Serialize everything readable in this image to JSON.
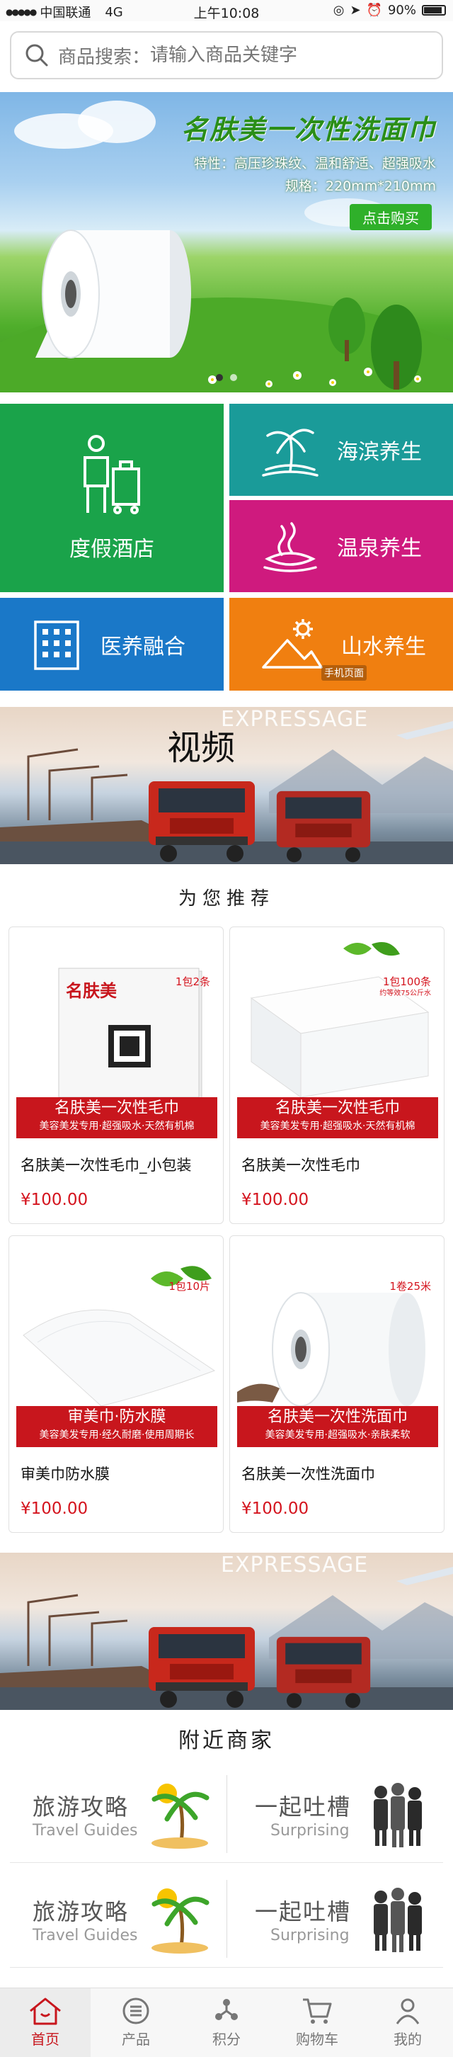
{
  "status_bar": {
    "carrier": "中国联通",
    "network": "4G",
    "time": "上午10:08",
    "battery": "90%",
    "battery_level": 0.9
  },
  "search": {
    "label": "商品搜索：",
    "placeholder": "请输入商品关键字"
  },
  "banner": {
    "title": "名肤美一次性洗面巾",
    "features": "特性：高压珍珠纹、温和舒适、超强吸水",
    "spec": "规格：220mm*210mm",
    "button": "点击购买",
    "slides": 2,
    "active_slide": 1
  },
  "categories": [
    {
      "label": "度假酒店",
      "icon": "traveler-luggage-icon",
      "color": "#1aa34a"
    },
    {
      "label": "海滨养生",
      "icon": "palm-island-icon",
      "color": "#1a9b99"
    },
    {
      "label": "温泉养生",
      "icon": "hot-spring-icon",
      "color": "#cf1a7e"
    },
    {
      "label": "医养融合",
      "icon": "building-icon",
      "color": "#1a78c8"
    },
    {
      "label": "山水养生",
      "icon": "mountain-sun-icon",
      "color": "#f07f10"
    }
  ],
  "category_watermark": "手机页面",
  "video_banner": {
    "overlay": "EXPRESSAGE",
    "label": "视频"
  },
  "promo_banner": {
    "overlay": "EXPRESSAGE"
  },
  "recommend": {
    "title": "为您推荐",
    "products": [
      {
        "name": "名肤美一次性毛巾_小包装",
        "price": "¥100.00",
        "pack": "1包2条",
        "bar_title": "名肤美一次性毛巾",
        "bar_sub": "美容美发专用·超强吸水·天然有机棉",
        "icon": "towel-pack-icon",
        "brand": "名肤美"
      },
      {
        "name": "名肤美一次性毛巾",
        "price": "¥100.00",
        "pack": "1包100条",
        "pack_sub": "约等效75公斤水",
        "bar_title": "名肤美一次性毛巾",
        "bar_sub": "美容美发专用·超强吸水·天然有机棉",
        "icon": "towel-stack-icon"
      },
      {
        "name": "审美巾防水膜",
        "price": "¥100.00",
        "pack": "1包10片",
        "bar_title": "审美巾·防水膜",
        "bar_sub": "美容美发专用·经久耐磨·使用周期长",
        "icon": "film-sheet-icon"
      },
      {
        "name": "名肤美一次性洗面巾",
        "price": "¥100.00",
        "pack": "1卷25米",
        "bar_title": "名肤美一次性洗面巾",
        "bar_sub": "美容美发专用·超强吸水·亲肤柔软",
        "icon": "towel-roll-icon"
      }
    ]
  },
  "nearby": {
    "title": "附近商家",
    "rows": [
      [
        {
          "cn": "旅游攻略",
          "en": "Travel Guides",
          "icon": "palm-island-icon"
        },
        {
          "cn": "一起吐槽",
          "en": "Surprising",
          "icon": "business-people-icon"
        }
      ],
      [
        {
          "cn": "旅游攻略",
          "en": "Travel Guides",
          "icon": "palm-island-icon"
        },
        {
          "cn": "一起吐槽",
          "en": "Surprising",
          "icon": "business-people-icon"
        }
      ]
    ]
  },
  "tabbar": [
    {
      "label": "首页",
      "icon": "home-icon",
      "active": true
    },
    {
      "label": "产品",
      "icon": "list-icon",
      "active": false
    },
    {
      "label": "积分",
      "icon": "points-icon",
      "active": false
    },
    {
      "label": "购物车",
      "icon": "cart-icon",
      "active": false
    },
    {
      "label": "我的",
      "icon": "user-icon",
      "active": false
    }
  ],
  "colors": {
    "accent_red": "#c8161d",
    "price_red": "#d4141e",
    "banner_green": "#2fb02a"
  }
}
